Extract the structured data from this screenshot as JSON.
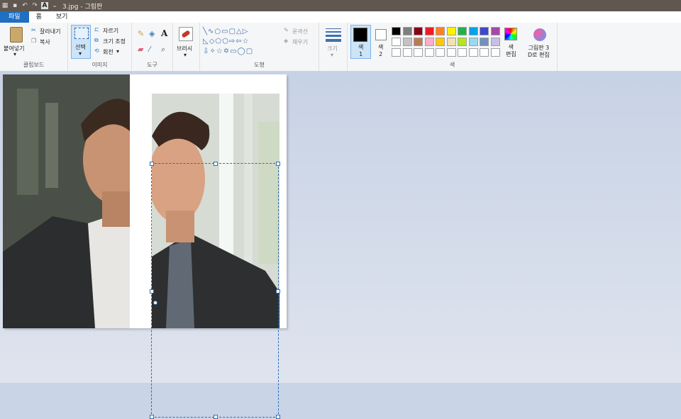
{
  "window": {
    "title": "3.jpg - 그림판"
  },
  "tabs": [
    {
      "label": "파일"
    },
    {
      "label": "홈"
    },
    {
      "label": "보기"
    }
  ],
  "clipboard": {
    "paste": "붙여넣기",
    "cut": "잘라내기",
    "copy": "복사",
    "group": "클립보드"
  },
  "image": {
    "select": "선택",
    "crop": "자르기",
    "resize": "크기 조정",
    "rotate": "회전",
    "group": "이미지"
  },
  "tools": {
    "group": "도구"
  },
  "brushes": {
    "label": "브러시"
  },
  "shapes": {
    "outline": "윤곽선",
    "fill": "채우기",
    "group": "도형"
  },
  "size": {
    "label": "크기"
  },
  "colors": {
    "color1": "색\n1",
    "color2": "색\n2",
    "group": "색",
    "edit": "색\n편집",
    "color1_value": "#000000",
    "color2_value": "#ffffff",
    "palette_row1": [
      "#000000",
      "#7f7f7f",
      "#880015",
      "#ed1c24",
      "#ff7f27",
      "#fff200",
      "#22b14c",
      "#00a2e8",
      "#3f48cc",
      "#a349a4"
    ],
    "palette_row2": [
      "#ffffff",
      "#c3c3c3",
      "#b97a57",
      "#ffaec9",
      "#ffc90e",
      "#efe4b0",
      "#b5e61d",
      "#99d9ea",
      "#7092be",
      "#c8bfe7"
    ],
    "palette_row3": [
      "#ffffff",
      "#ffffff",
      "#ffffff",
      "#ffffff",
      "#ffffff",
      "#ffffff",
      "#ffffff",
      "#ffffff",
      "#ffffff",
      "#ffffff"
    ]
  },
  "paint3d": {
    "label": "그림판 3\nD로 편집"
  }
}
